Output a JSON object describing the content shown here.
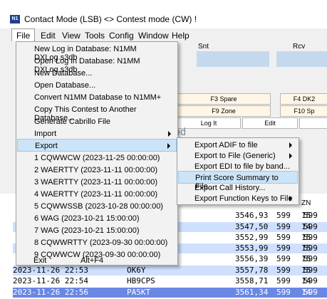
{
  "window": {
    "title": "Contact Mode (LSB) <> Contest mode (CW) !",
    "icon_text": "N1"
  },
  "menubar": [
    "File",
    "Edit",
    "View",
    "Tools",
    "Config",
    "Window",
    "Help"
  ],
  "labels": {
    "snt": "Snt",
    "rcv": "Rcv"
  },
  "fkeys": {
    "f3": "F3 Spare",
    "f4": "F4 DK2",
    "f9": "F9 Zone",
    "f10": "F10 Sp",
    "log_it": "Log It",
    "edit": "Edit"
  },
  "background_fragment": "lod",
  "file_menu": [
    {
      "label": "New Log in Database: N1MM DXLog.s3db"
    },
    {
      "label": "Open Log in Database: N1MM DXLog.s3db"
    },
    {
      "label": "New Database..."
    },
    {
      "label": "Open Database..."
    },
    {
      "label": "Convert N1MM Database to N1MM+"
    },
    {
      "label": "Copy This Contest to Another Database..."
    },
    {
      "label": "Generate Cabrillo File"
    },
    {
      "label": "Import",
      "submenu": true
    },
    {
      "label": "Export",
      "submenu": true
    },
    {
      "label": "1 CQWWCW (2023-11-25 00:00:00)"
    },
    {
      "label": "2 WAERTTY (2023-11-11 00:00:00)"
    },
    {
      "label": "3 WAERTTY (2023-11-11 00:00:00)"
    },
    {
      "label": "4 WAERTTY (2023-11-11 00:00:00)"
    },
    {
      "label": "5 CQWWSSB (2023-10-28 00:00:00)"
    },
    {
      "label": "6 WAG (2023-10-21 15:00:00)"
    },
    {
      "label": "7 WAG (2023-10-21 15:00:00)"
    },
    {
      "label": "8 CQWWRTTY (2023-09-30 00:00:00)"
    },
    {
      "label": "9 CQWWCW (2023-09-30 00:00:00)"
    },
    {
      "label": "Exit",
      "accel": "Alt+F4"
    }
  ],
  "export_menu": [
    {
      "label": "Export ADIF to file",
      "submenu": true
    },
    {
      "label": "Export to File (Generic)",
      "submenu": true
    },
    {
      "label": "Export EDI to file by band..."
    },
    {
      "label": "Print Score Summary to File..."
    },
    {
      "label": "Export Call History..."
    },
    {
      "label": "Export Function Keys to File",
      "submenu": true
    }
  ],
  "log": {
    "zn_header": "ZN",
    "rows": [
      {
        "date": "",
        "call": "",
        "freq": "3546,93",
        "snt": "599",
        "rcv": "599",
        "zn": "15"
      },
      {
        "date": "",
        "call": "",
        "freq": "3547,50",
        "snt": "599",
        "rcv": "599",
        "zn": "14"
      },
      {
        "date": "",
        "call": "",
        "freq": "3552,99",
        "snt": "599",
        "rcv": "599",
        "zn": "15"
      },
      {
        "date": "",
        "call": "",
        "freq": "3553,99",
        "snt": "599",
        "rcv": "599",
        "zn": "15"
      },
      {
        "date": "",
        "call": "",
        "freq": "3556,39",
        "snt": "599",
        "rcv": "599",
        "zn": "15"
      },
      {
        "date": "2023-11-26 22:53",
        "call": "OK6Y",
        "freq": "3557,78",
        "snt": "599",
        "rcv": "599",
        "zn": "15"
      },
      {
        "date": "2023-11-26 22:54",
        "call": "HB9CPS",
        "freq": "3558,71",
        "snt": "599",
        "rcv": "599",
        "zn": "14"
      },
      {
        "date": "2023-11-26 22:56",
        "call": "PA5KT",
        "freq": "3561,34",
        "snt": "599",
        "rcv": "599",
        "zn": "14"
      }
    ]
  }
}
